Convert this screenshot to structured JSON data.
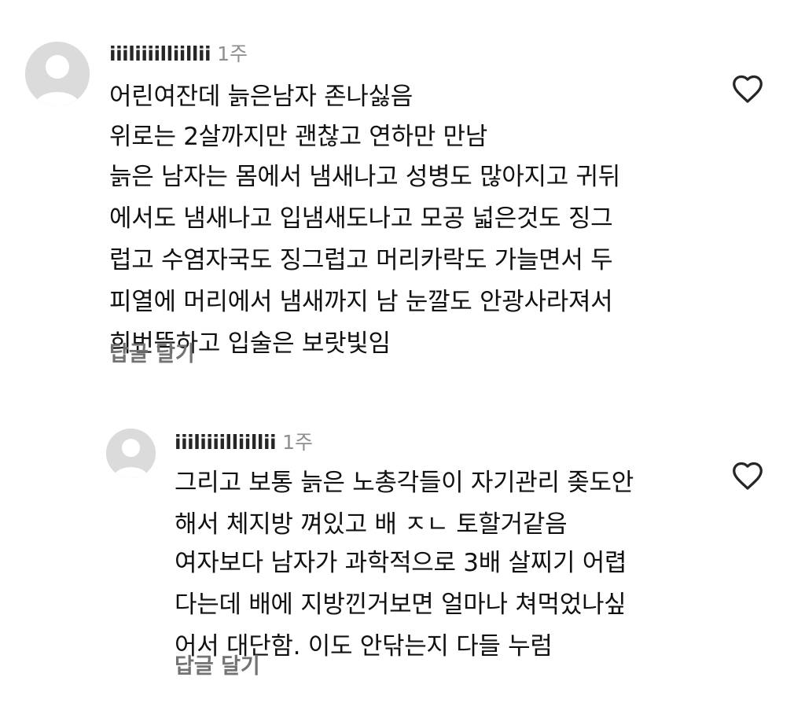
{
  "comments": [
    {
      "username": "iiiliiiilliillii",
      "time": "1주",
      "paragraphs": [
        [
          "어린여잔데 늙은남자 존나싫음"
        ],
        [
          "위로는 2살까지만 괜찮고 연하만 만남"
        ],
        [
          "늙은 남자는 몸에서 냄새나고 성병도 많아지고 귀뒤",
          "에서도 냄새나고 입냄새도나고 모공 넓은것도 징그",
          "럽고 수염자국도 징그럽고 머리카락도 가늘면서 두",
          "피열에 머리에서 냄새까지 남 눈깔도 안광사라져서",
          "희번뜩하고 입술은 보랏빛임"
        ]
      ],
      "reply_label": "답글 달기",
      "like_icon": "heart-outline-icon"
    },
    {
      "username": "iiiliiiilliillii",
      "time": "1주",
      "paragraphs": [
        [
          "그리고 보통 늙은 노총각들이 자기관리 좆도안",
          "해서 체지방 껴있고 배 ㅈㄴ 토할거같음"
        ],
        [
          "여자보다 남자가 과학적으로 3배 살찌기 어렵",
          "다는데 배에 지방낀거보면 얼마나 쳐먹었나싶",
          "어서 대단함. 이도 안닦는지 다들 누럼"
        ]
      ],
      "reply_label": "답글 달기",
      "like_icon": "heart-outline-icon"
    }
  ]
}
